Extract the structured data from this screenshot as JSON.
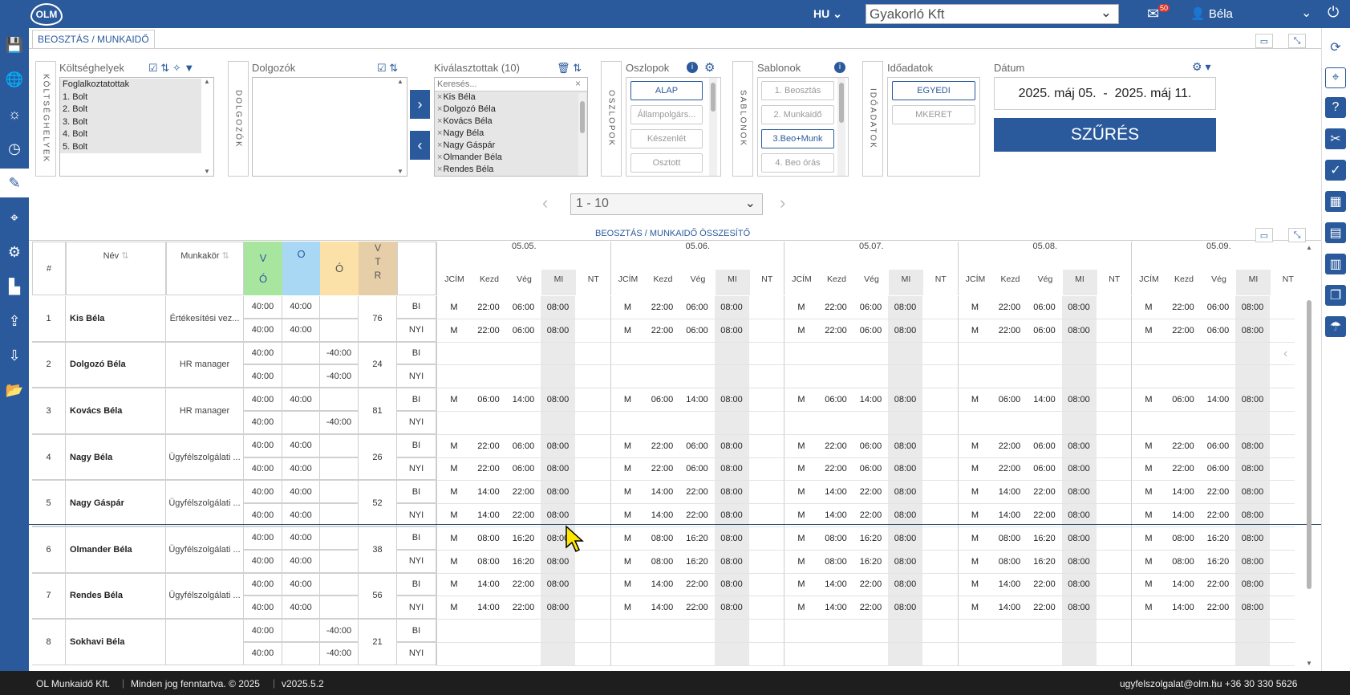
{
  "topbar": {
    "logo": "OLM",
    "lang": "HU",
    "company": "Gyakorló Kft",
    "mail_badge": "50",
    "user": "Béla"
  },
  "tab": {
    "title": "BEOSZTÁS / MUNKAIDŐ"
  },
  "filters": {
    "cost_centers": {
      "title": "Költséghelyek",
      "vlabel": "KÖLTSÉGHELYEK",
      "items": [
        "Foglalkoztatottak",
        "1. Bolt",
        "2. Bolt",
        "3. Bolt",
        "4. Bolt",
        "5. Bolt"
      ]
    },
    "employees": {
      "title": "Dolgozók",
      "vlabel": "DOLGOZÓK"
    },
    "selected": {
      "title": "Kiválasztottak (10)",
      "placeholder": "Keresés...",
      "items": [
        "Kis Béla",
        "Dolgozó Béla",
        "Kovács Béla",
        "Nagy Béla",
        "Nagy Gáspár",
        "Olmander Béla",
        "Rendes Béla"
      ]
    },
    "columns": {
      "title": "Oszlopok",
      "vlabel": "OSZLOPOK",
      "buttons": [
        "ALAP",
        "Állampolgárs...",
        "Készenlét",
        "Osztott"
      ]
    },
    "templates": {
      "title": "Sablonok",
      "vlabel": "SABLONOK",
      "buttons": [
        "1. Beosztás",
        "2. Munkaidő",
        "3.Beo+Munk",
        "4. Beo órás"
      ]
    },
    "timedata": {
      "title": "Időadatok",
      "vlabel": "IDŐADATOK",
      "buttons": [
        "EGYEDI",
        "MKERET"
      ]
    },
    "date": {
      "title": "Dátum",
      "range": "2025. máj 05.  -  2025. máj 11.",
      "filter_label": "SZŰRÉS"
    }
  },
  "pager": {
    "value": "1 - 10"
  },
  "summary_title": "BEOSZTÁS / MUNKAIDŐ ÖSSZESÍTŐ",
  "table": {
    "headers": {
      "num": "#",
      "name": "Név",
      "role": "Munkakör",
      "vo": "V\nÓ",
      "o1": "O",
      "o2": "Ó",
      "vtr": "V\nT\nR"
    },
    "days": [
      "05.05.",
      "05.06.",
      "05.07.",
      "05.08.",
      "05.09."
    ],
    "subcols": [
      "JCÍM",
      "Kezd",
      "Vég",
      "MI",
      "NT"
    ],
    "rows": [
      {
        "n": "1",
        "name": "Kis Béla",
        "role": "Értékesítési vez...",
        "a1": "40:00",
        "b1": "40:00",
        "c1": "",
        "a2": "40:00",
        "b2": "40:00",
        "c2": "",
        "t": "76",
        "l1": "BI",
        "l2": "NYI",
        "s1": [
          "M",
          "22:00",
          "06:00",
          "08:00"
        ],
        "s2": [
          "M",
          "22:00",
          "06:00",
          "08:00"
        ]
      },
      {
        "n": "2",
        "name": "Dolgozó Béla",
        "role": "HR manager",
        "a1": "40:00",
        "b1": "",
        "c1": "-40:00",
        "a2": "40:00",
        "b2": "",
        "c2": "-40:00",
        "t": "24",
        "l1": "BI",
        "l2": "NYI",
        "s1": [
          "",
          "",
          "",
          ""
        ],
        "s2": [
          "",
          "",
          "",
          ""
        ]
      },
      {
        "n": "3",
        "name": "Kovács Béla",
        "role": "HR manager",
        "a1": "40:00",
        "b1": "40:00",
        "c1": "",
        "a2": "40:00",
        "b2": "",
        "c2": "-40:00",
        "t": "81",
        "l1": "BI",
        "l2": "NYI",
        "s1": [
          "M",
          "06:00",
          "14:00",
          "08:00"
        ],
        "s2": [
          "",
          "",
          "",
          ""
        ]
      },
      {
        "n": "4",
        "name": "Nagy Béla",
        "role": "Ügyfélszolgálati ...",
        "a1": "40:00",
        "b1": "40:00",
        "c1": "",
        "a2": "40:00",
        "b2": "40:00",
        "c2": "",
        "t": "26",
        "l1": "BI",
        "l2": "NYI",
        "s1": [
          "M",
          "22:00",
          "06:00",
          "08:00"
        ],
        "s2": [
          "M",
          "22:00",
          "06:00",
          "08:00"
        ]
      },
      {
        "n": "5",
        "name": "Nagy Gáspár",
        "role": "Ügyfélszolgálati ...",
        "a1": "40:00",
        "b1": "40:00",
        "c1": "",
        "a2": "40:00",
        "b2": "40:00",
        "c2": "",
        "t": "52",
        "l1": "BI",
        "l2": "NYI",
        "s1": [
          "M",
          "14:00",
          "22:00",
          "08:00"
        ],
        "s2": [
          "M",
          "14:00",
          "22:00",
          "08:00"
        ]
      },
      {
        "n": "6",
        "name": "Olmander Béla",
        "role": "Ügyfélszolgálati ...",
        "a1": "40:00",
        "b1": "40:00",
        "c1": "",
        "a2": "40:00",
        "b2": "40:00",
        "c2": "",
        "t": "38",
        "l1": "BI",
        "l2": "NYI",
        "s1": [
          "M",
          "08:00",
          "16:20",
          "08:00"
        ],
        "s2": [
          "M",
          "08:00",
          "16:20",
          "08:00"
        ]
      },
      {
        "n": "7",
        "name": "Rendes Béla",
        "role": "Ügyfélszolgálati ...",
        "a1": "40:00",
        "b1": "40:00",
        "c1": "",
        "a2": "40:00",
        "b2": "40:00",
        "c2": "",
        "t": "56",
        "l1": "BI",
        "l2": "NYI",
        "s1": [
          "M",
          "14:00",
          "22:00",
          "08:00"
        ],
        "s2": [
          "M",
          "14:00",
          "22:00",
          "08:00"
        ]
      },
      {
        "n": "8",
        "name": "Sokhavi Béla",
        "role": "",
        "a1": "40:00",
        "b1": "",
        "c1": "-40:00",
        "a2": "40:00",
        "b2": "",
        "c2": "-40:00",
        "t": "21",
        "l1": "BI",
        "l2": "NYI",
        "s1": [
          "",
          "",
          "",
          ""
        ],
        "s2": [
          "",
          "",
          "",
          ""
        ]
      }
    ]
  },
  "footer": {
    "company": "OL Munkaidő Kft.",
    "rights": "Minden jog fenntartva. © 2025",
    "version": "v2025.5.2",
    "email": "ugyfelszolgalat@olm.hu",
    "phone": "+36 30 330 5626"
  },
  "colors": {
    "primary": "#2a5a9c",
    "vo_green": "#a8e6a0",
    "o_blue": "#a9d8f5",
    "o_yellow": "#fbe0a8",
    "vtr_tan": "#e6cfa8"
  }
}
